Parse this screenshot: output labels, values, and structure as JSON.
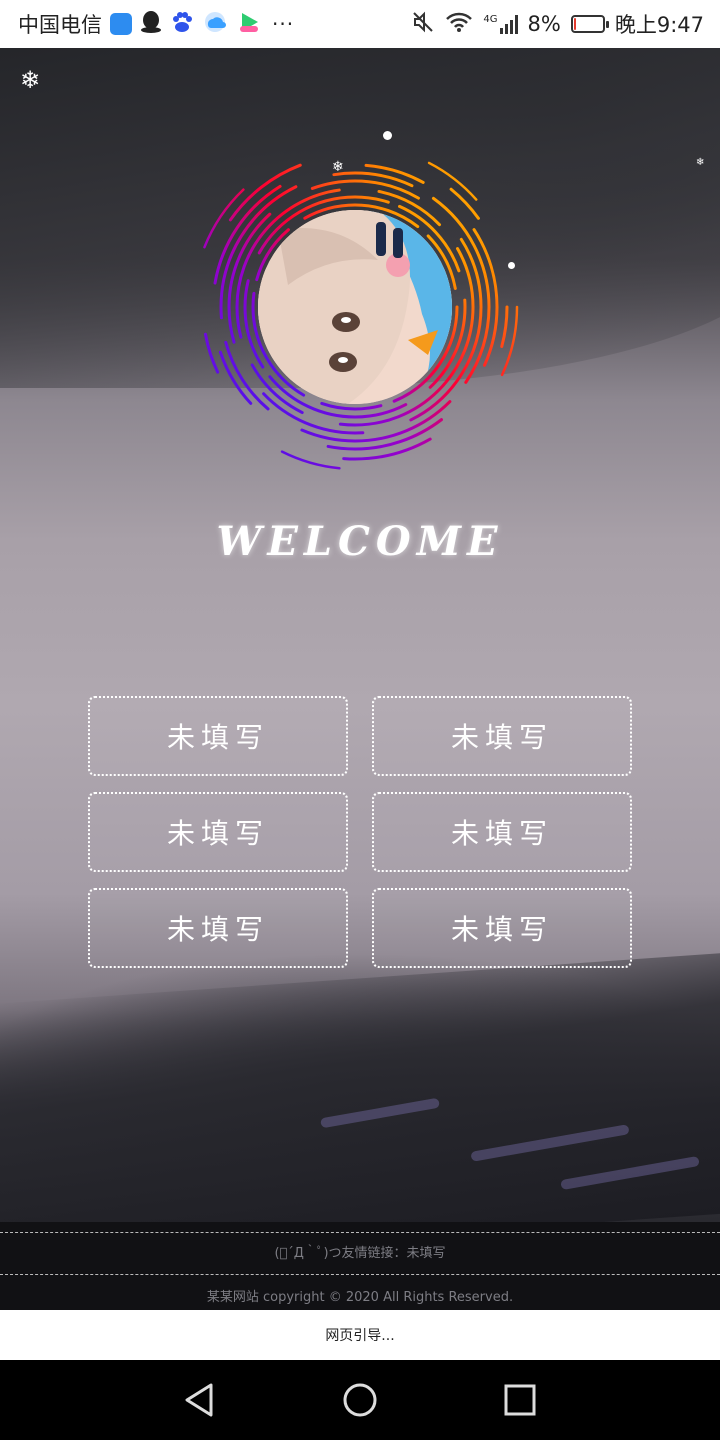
{
  "status_bar": {
    "carrier": "中国电信",
    "network": "4G",
    "battery_percent": "8%",
    "time": "晚上9:47",
    "more": "···",
    "icons": [
      "shield-app-icon",
      "qq-icon",
      "baidu-icon",
      "cloud-app-icon",
      "video-app-icon",
      "mute-icon",
      "wifi-icon",
      "signal-icon",
      "battery-icon"
    ],
    "battery_level": 0.08,
    "battery_color": "#e23b2e"
  },
  "hero": {
    "welcome_text": "WELCOME",
    "ring_colors": [
      "#ff0000",
      "#ff8a00",
      "#ffd800",
      "#7a00ff",
      "#2b1bff"
    ]
  },
  "links": [
    {
      "label": "未填写"
    },
    {
      "label": "未填写"
    },
    {
      "label": "未填写"
    },
    {
      "label": "未填写"
    },
    {
      "label": "未填写"
    },
    {
      "label": "未填写"
    }
  ],
  "footer": {
    "friend_links": "(ﾟ´Д｀ﾟ)つ友情链接：未填写",
    "copyright": "某某网站 copyright © 2020 All Rights Reserved."
  },
  "loading_text": "网页引导...",
  "nav": {
    "back": "back-triangle-icon",
    "home": "home-circle-icon",
    "recents": "recents-square-icon"
  }
}
